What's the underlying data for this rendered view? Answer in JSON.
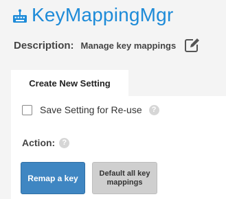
{
  "app": {
    "title": "KeyMappingMgr",
    "icon": "keyboard-icon",
    "title_color": "#1e8bd8"
  },
  "description": {
    "label": "Description:",
    "value": "Manage key mappings",
    "edit_icon": "edit-icon"
  },
  "tabs": [
    {
      "label": "Create New Setting",
      "active": true
    }
  ],
  "form": {
    "save_setting_label": "Save Setting for Re-use",
    "save_setting_checked": false,
    "action_label": "Action:",
    "help_icon_glyph": "?"
  },
  "buttons": {
    "remap_label": "Remap a key",
    "default_all_label": "Default all key mappings",
    "primary_color": "#3f86c2",
    "secondary_color": "#cfcfcf"
  }
}
